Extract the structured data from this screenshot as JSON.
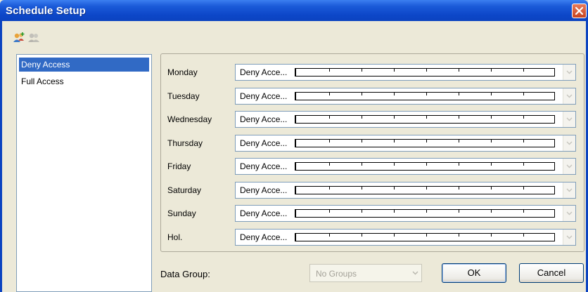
{
  "window": {
    "title": "Schedule Setup"
  },
  "toolbar": {
    "icons": [
      "add-users-icon",
      "users-icon"
    ]
  },
  "schedules": [
    {
      "label": "Deny Access",
      "selected": true
    },
    {
      "label": "Full Access",
      "selected": false
    }
  ],
  "days": [
    {
      "label": "Monday",
      "value": "Deny Acce..."
    },
    {
      "label": "Tuesday",
      "value": "Deny Acce..."
    },
    {
      "label": "Wednesday",
      "value": "Deny Acce..."
    },
    {
      "label": "Thursday",
      "value": "Deny Acce..."
    },
    {
      "label": "Friday",
      "value": "Deny Acce..."
    },
    {
      "label": "Saturday",
      "value": "Deny Acce..."
    },
    {
      "label": "Sunday",
      "value": "Deny Acce..."
    },
    {
      "label": "Hol.",
      "value": "Deny Acce..."
    }
  ],
  "data_group": {
    "label": "Data Group:",
    "value": "No Groups"
  },
  "buttons": {
    "ok": "OK",
    "cancel": "Cancel"
  },
  "colors": {
    "titlebar": "#0b43c0",
    "selection": "#316ac5",
    "dialog_bg": "#ece9d8"
  }
}
